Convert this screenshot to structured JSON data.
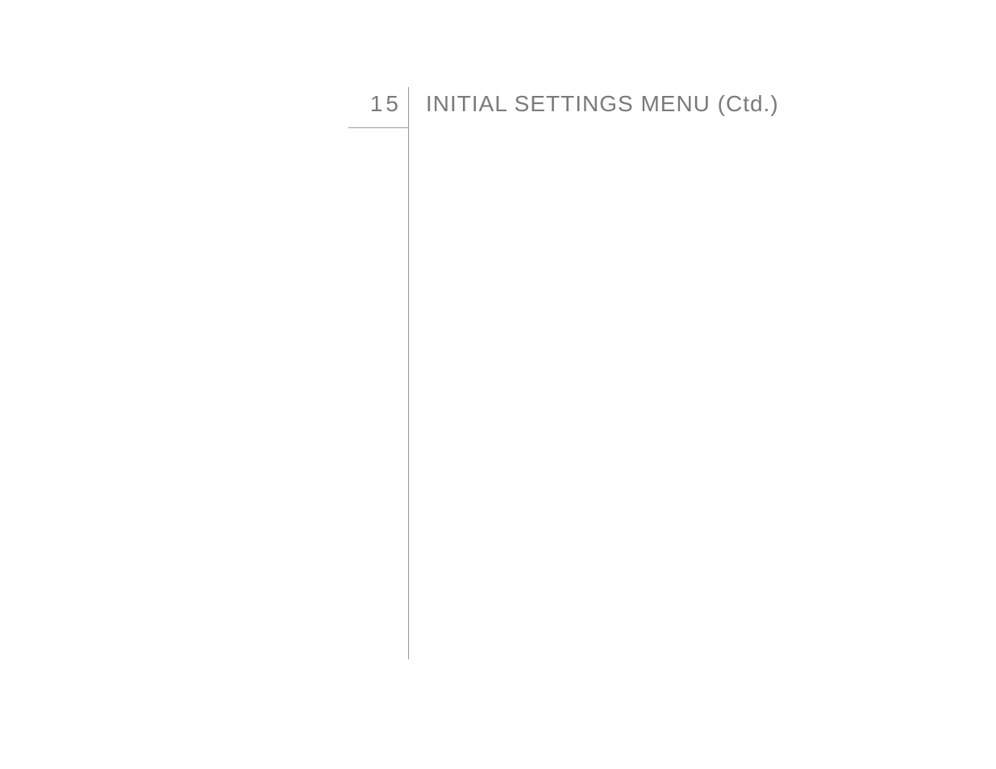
{
  "header": {
    "section_number": "15",
    "section_title": "INITIAL SETTINGS MENU (Ctd.)"
  }
}
